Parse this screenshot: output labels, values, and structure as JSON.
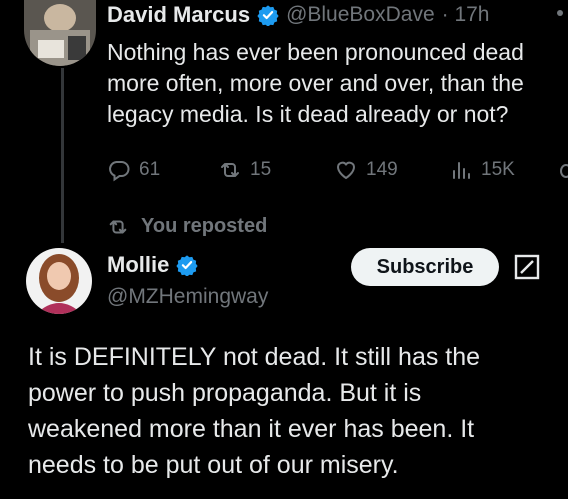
{
  "tweet": {
    "name": "David Marcus",
    "handle": "@BlueBoxDave",
    "time": "· 17h",
    "text_lines": [
      "Nothing has ever been pronounced dead",
      "more often, more over and over, than the",
      "legacy media. Is it dead already or not?"
    ],
    "replies": "61",
    "reposts": "15",
    "likes": "149",
    "views": "15K"
  },
  "repost_note": "You reposted",
  "reply": {
    "name": "Mollie",
    "handle": "@MZHemingway",
    "subscribe_label": "Subscribe",
    "text_lines": [
      "It is DEFINITELY not dead. It still has the",
      "power to push propaganda. But it is",
      "weakened more than it ever has been. It",
      "needs to be put out of our misery."
    ]
  },
  "colors": {
    "background": "#000000",
    "text": "#e7e9ea",
    "muted": "#71767b",
    "verified": "#1d9bf0"
  }
}
